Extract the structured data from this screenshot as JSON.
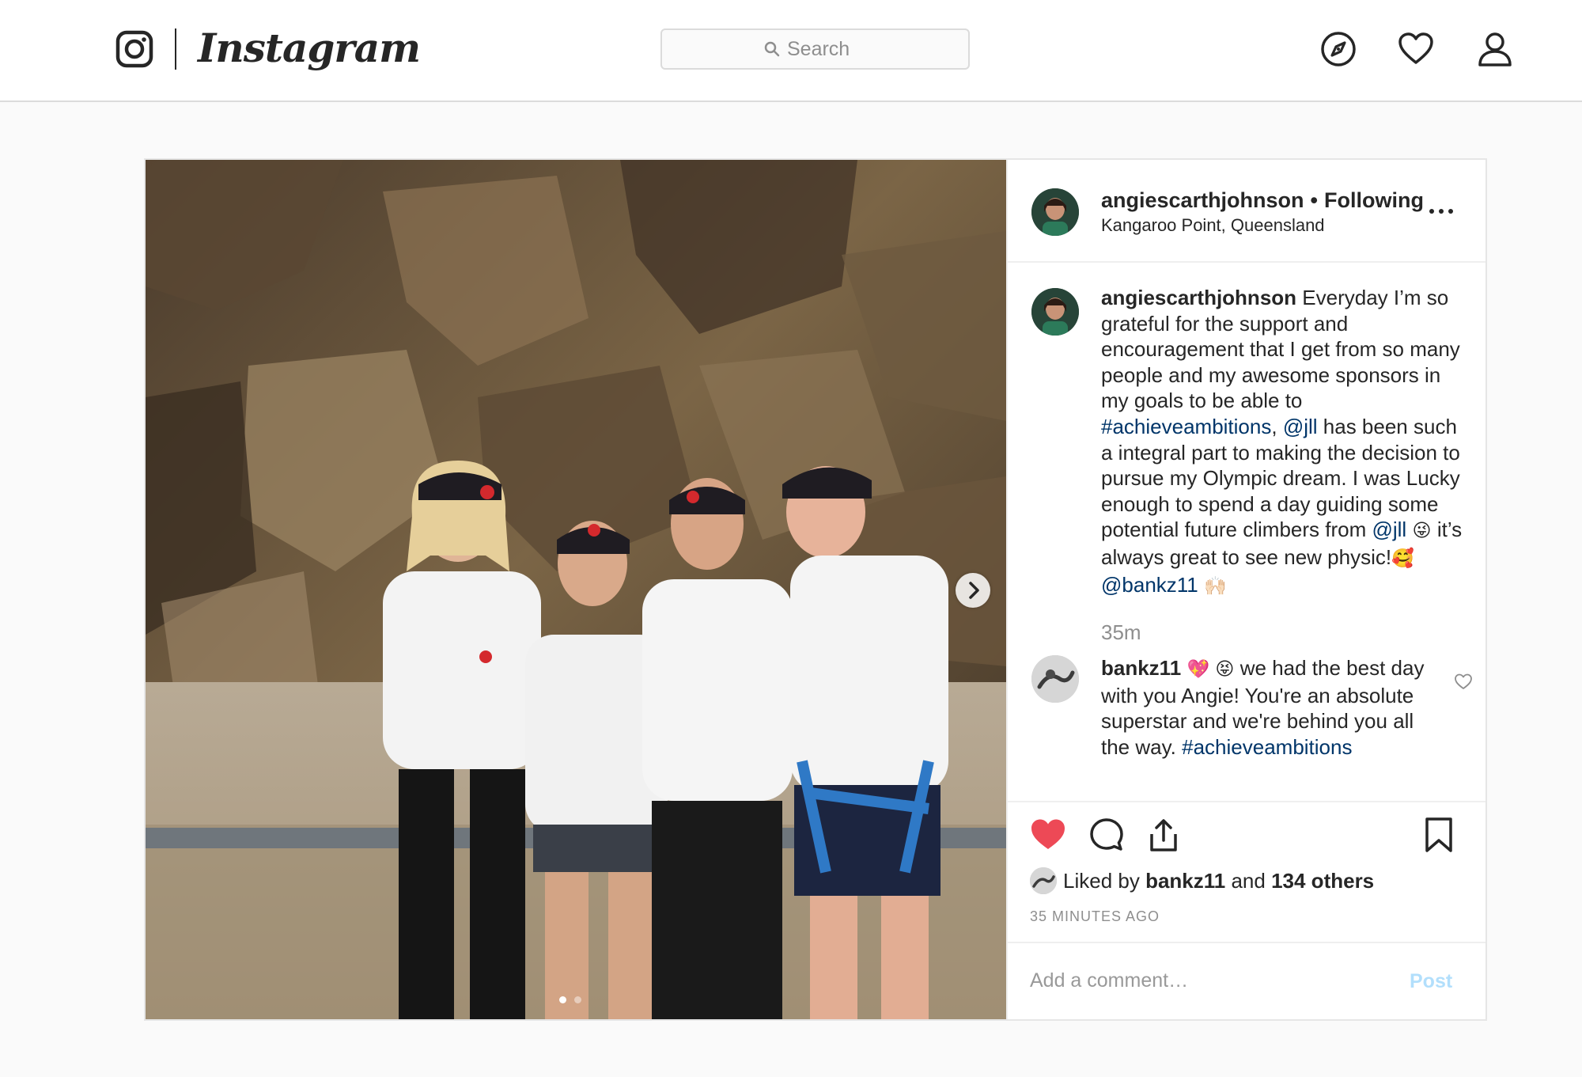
{
  "nav": {
    "brand": "Instagram",
    "search_placeholder": "Search",
    "icons": [
      "camera-logo-icon",
      "explore-compass-icon",
      "activity-heart-icon",
      "profile-icon"
    ]
  },
  "post": {
    "author": "angiescarthjohnson",
    "separator": "•",
    "follow_status": "Following",
    "location": "Kangaroo Point, Queensland",
    "caption": {
      "username": "angiescarthjohnson",
      "segments": [
        {
          "t": " Everyday I’m so grateful for the support and encouragement that I get from so many people and my awesome sponsors in my goals to be able to ",
          "kind": "text"
        },
        {
          "t": "#achieveambitions",
          "kind": "link"
        },
        {
          "t": ", ",
          "kind": "text"
        },
        {
          "t": "@jll",
          "kind": "link"
        },
        {
          "t": " has been such a integral part to making the decision to pursue my Olympic dream. I was Lucky enough to spend a day guiding some potential future climbers from ",
          "kind": "text"
        },
        {
          "t": "@jll",
          "kind": "link"
        },
        {
          "t": " 😜 ",
          "kind": "emoji"
        },
        {
          "t": "it’s always great to see new physic!",
          "kind": "text"
        },
        {
          "t": "🥰",
          "kind": "emoji"
        },
        {
          "t": "  ",
          "kind": "text"
        },
        {
          "t": "@bankz11",
          "kind": "link"
        },
        {
          "t": " 🙌🏻",
          "kind": "emoji"
        }
      ]
    },
    "time_since": "35m",
    "comment": {
      "username": "bankz11",
      "segments": [
        {
          "t": " 💖 😝 ",
          "kind": "emoji"
        },
        {
          "t": " we had the best day with you Angie! You're an absolute superstar and we're behind you all the way. ",
          "kind": "text"
        },
        {
          "t": "#achieveambitions",
          "kind": "link"
        }
      ]
    },
    "likes": {
      "prefix": "Liked by ",
      "user": "bankz11",
      "middle": " and ",
      "others": "134 others"
    },
    "posted_ago": "35 MINUTES AGO",
    "add_comment_placeholder": "Add a comment…",
    "post_label": "Post",
    "like_state": "liked",
    "carousel": {
      "pages": 2,
      "current": 1
    }
  },
  "colors": {
    "accent_link": "#003569",
    "like_red": "#ed4956",
    "post_button_disabled": "#b2dffc",
    "muted": "#8e8e8e",
    "border": "#dbdbdb"
  }
}
